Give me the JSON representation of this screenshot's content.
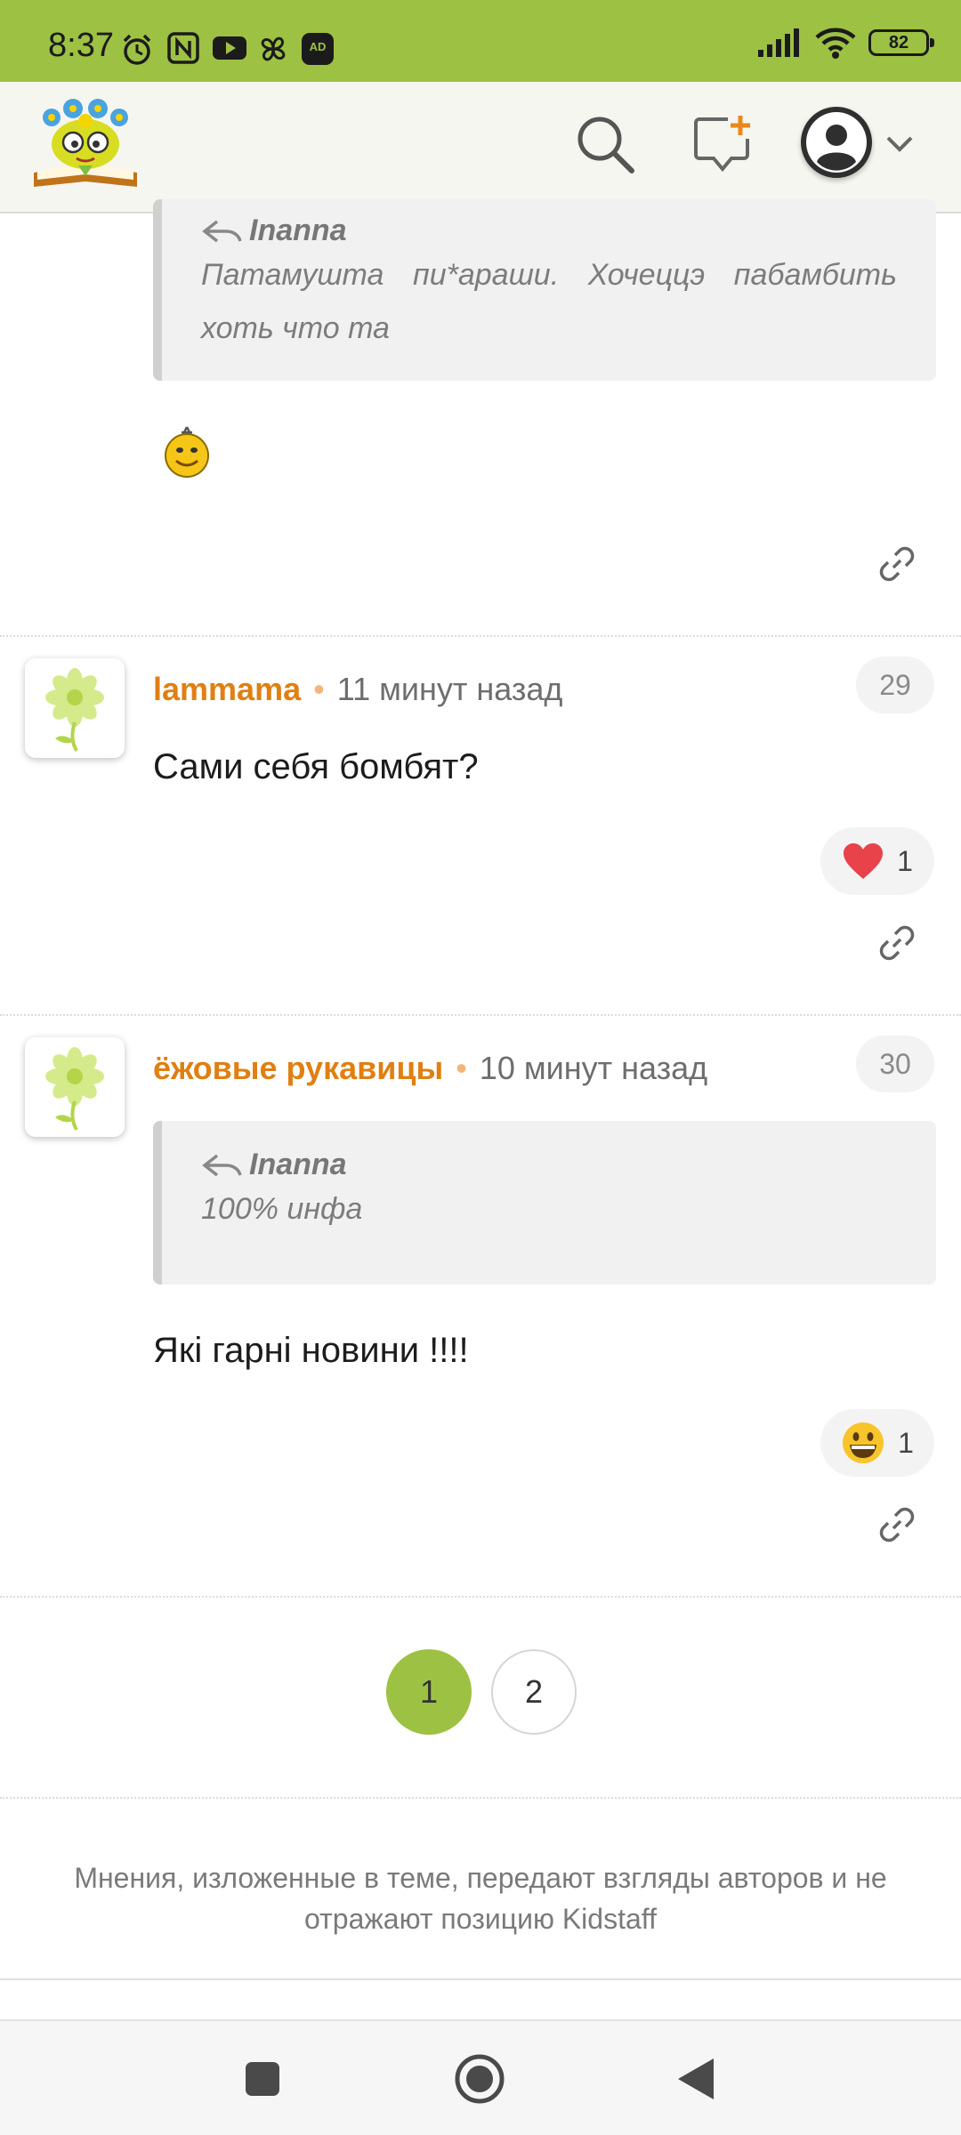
{
  "status_bar": {
    "time": "8:37",
    "battery": "82"
  },
  "comments": {
    "prev_quote": {
      "author": "Inanna",
      "text": "Патамушта пи*араши. Хочеццэ пабамбить хоть что та"
    },
    "items": [
      {
        "author": "lammama",
        "time": "11 минут назад",
        "number": "29",
        "text": "Сами себя бомбят?",
        "reaction_count": "1"
      },
      {
        "author": "ёжовые рукавицы",
        "time": "10 минут назад",
        "number": "30",
        "quote": {
          "author": "Inanna",
          "text": "100% инфа"
        },
        "text": "Які гарні новини !!!!",
        "reaction_count": "1"
      }
    ]
  },
  "pagination": {
    "pages": [
      "1",
      "2"
    ],
    "active": "1"
  },
  "disclaimer": "Мнения, изложенные в теме, передают взгляды авторов и не отражают позицию Kidstaff"
}
